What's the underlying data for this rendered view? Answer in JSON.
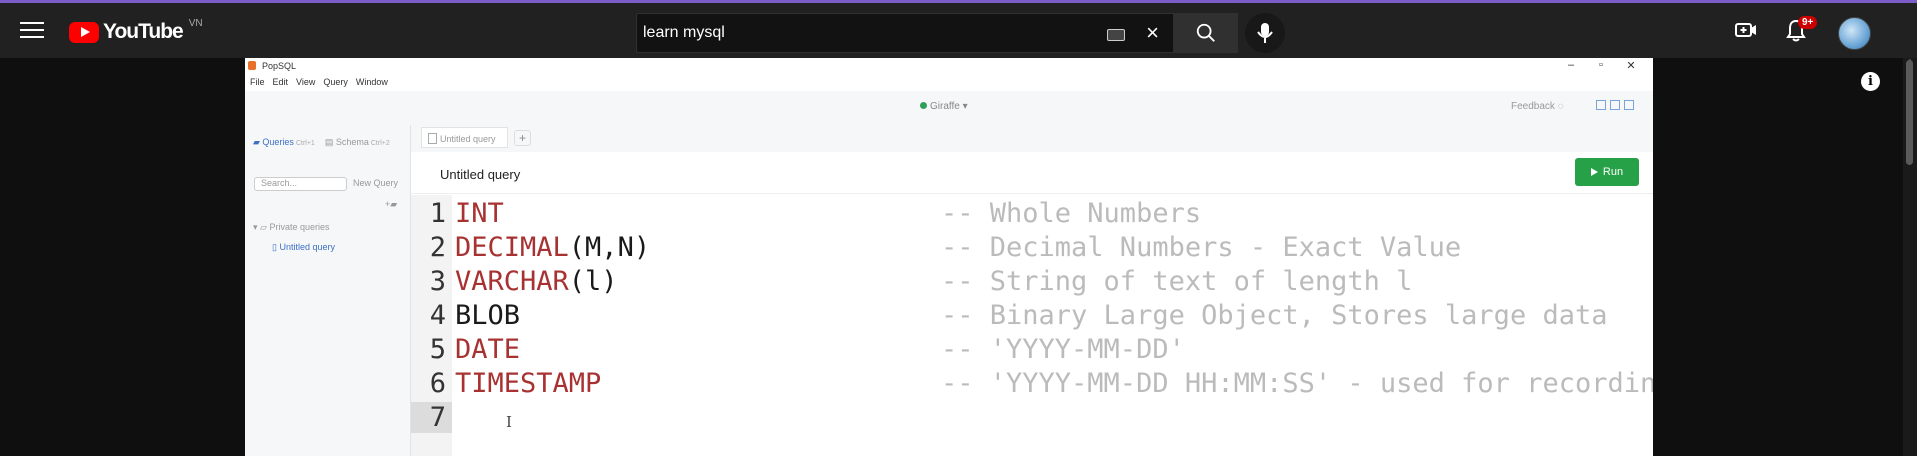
{
  "youtube": {
    "logo_text": "YouTube",
    "country_code": "VN",
    "search_query": "learn mysql",
    "notification_count": "9+",
    "icons": [
      "menu-icon",
      "search-icon",
      "mic-icon",
      "keyboard-icon",
      "clear-icon",
      "create-icon",
      "bell-icon",
      "info-icon"
    ]
  },
  "window": {
    "title": "PopSQL",
    "controls": [
      "–",
      "▫",
      "✕"
    ]
  },
  "menu": [
    "File",
    "Edit",
    "View",
    "Query",
    "Window"
  ],
  "toolbar": {
    "connection": "Giraffe",
    "connection_status_color": "#2ea05a",
    "feedback": "Feedback"
  },
  "sidebar": {
    "queries_tab": "Queries",
    "queries_shortcut": "Ctrl+1",
    "schema_tab": "Schema",
    "schema_shortcut": "Ctrl+2",
    "search_placeholder": "Search...",
    "new_query": "New Query",
    "group": "Private queries",
    "item": "Untitled query"
  },
  "tabs": {
    "active": "Untitled query",
    "add": "+"
  },
  "query": {
    "title": "Untitled query",
    "run_label": "Run",
    "run_color": "#26a148"
  },
  "editor": {
    "lines": [
      {
        "num": "1",
        "kw": "INT",
        "rest": "",
        "comment": "-- Whole Numbers"
      },
      {
        "num": "2",
        "kw": "DECIMAL",
        "rest": "(M,N)",
        "comment": "-- Decimal Numbers - Exact Value"
      },
      {
        "num": "3",
        "kw": "VARCHAR",
        "rest": "(l)",
        "comment": "-- String of text of length l"
      },
      {
        "num": "4",
        "kw": "",
        "rest": "BLOB",
        "comment": "-- Binary Large Object, Stores large data"
      },
      {
        "num": "5",
        "kw": "DATE",
        "rest": "",
        "comment": "-- 'YYYY-MM-DD'"
      },
      {
        "num": "6",
        "kw": "TIMESTAMP",
        "rest": "",
        "comment": "-- 'YYYY-MM-DD HH:MM:SS' - used for recording"
      },
      {
        "num": "7",
        "kw": "",
        "rest": "",
        "comment": ""
      }
    ],
    "keyword_color": "#a83232",
    "comment_color": "#bbbbbb"
  }
}
